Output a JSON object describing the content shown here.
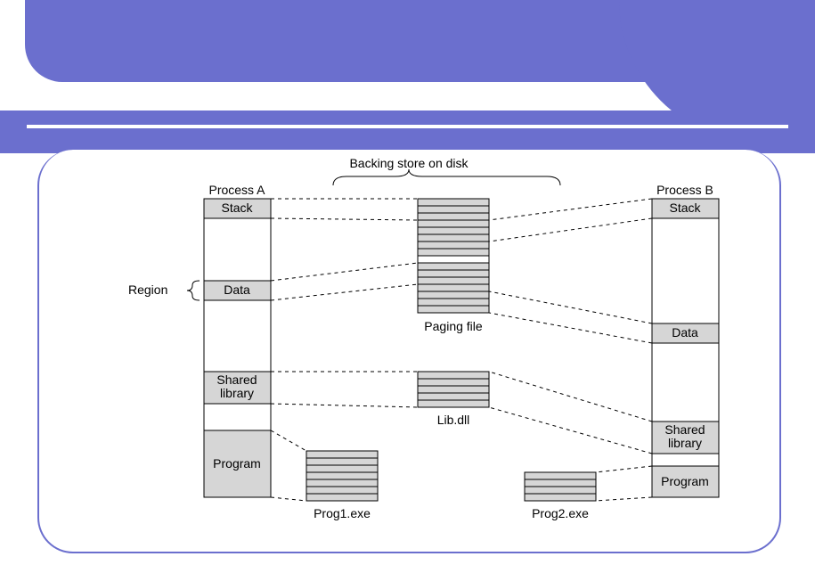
{
  "labels": {
    "title": "Backing store on disk",
    "processA": "Process A",
    "processB": "Process B",
    "region": "Region",
    "pagingFile": "Paging file",
    "libdll": "Lib.dll",
    "prog1": "Prog1.exe",
    "prog2": "Prog2.exe"
  },
  "procA": {
    "stack": "Stack",
    "data": "Data",
    "shlib": "Shared library",
    "program": "Program"
  },
  "procB": {
    "stack": "Stack",
    "data": "Data",
    "shlib": "Shared library",
    "program": "Program"
  }
}
